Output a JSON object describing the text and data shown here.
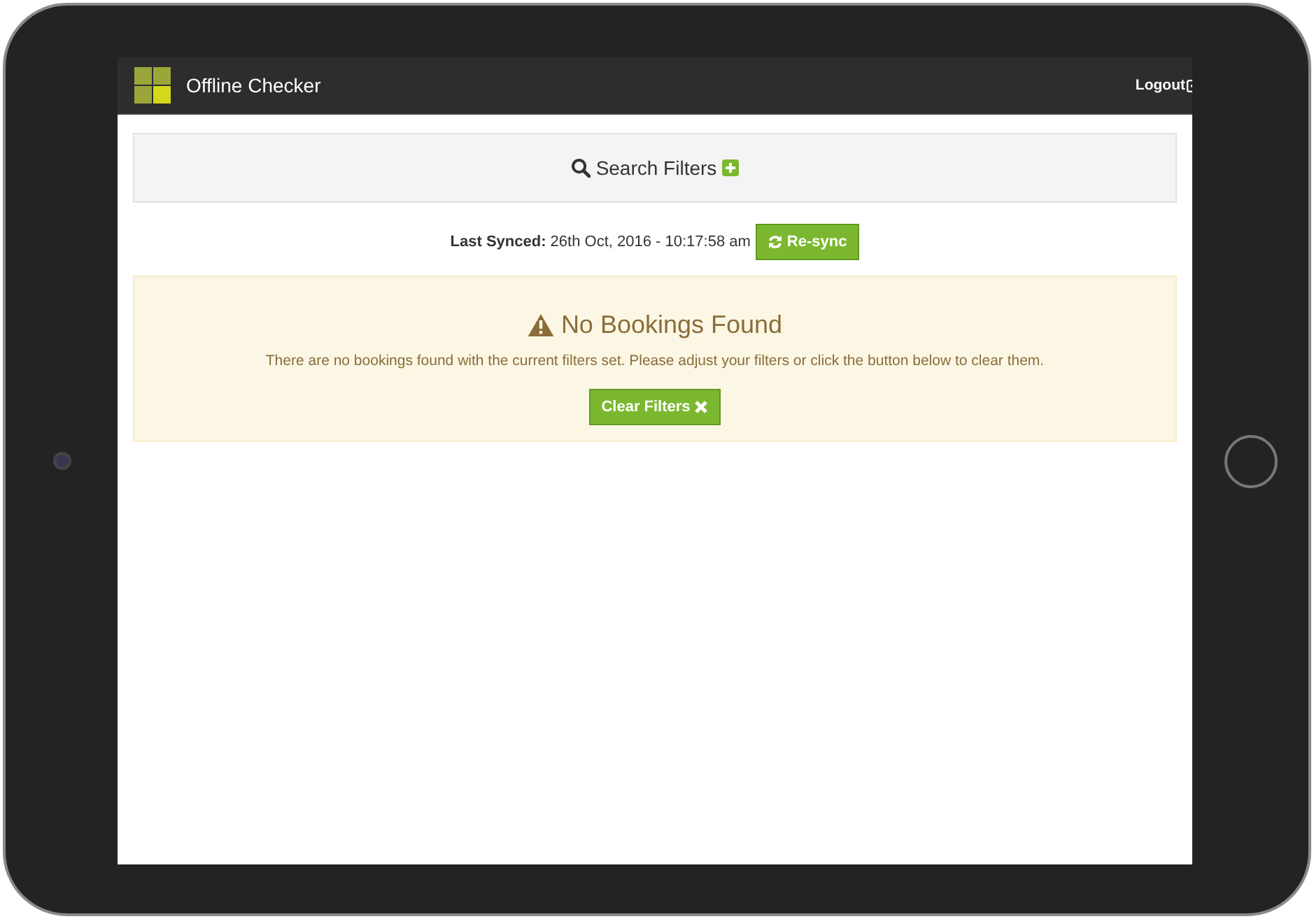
{
  "navbar": {
    "title": "Offline Checker",
    "logout": "Logout"
  },
  "filters": {
    "label": "Search Filters"
  },
  "sync": {
    "label": "Last Synced:",
    "value": "26th Oct, 2016 - 10:17:58 am",
    "button": "Re-sync"
  },
  "alert": {
    "title": "No Bookings Found",
    "message": "There are no bookings found with the current filters set. Please adjust your filters or click the button below to clear them.",
    "button": "Clear Filters"
  }
}
